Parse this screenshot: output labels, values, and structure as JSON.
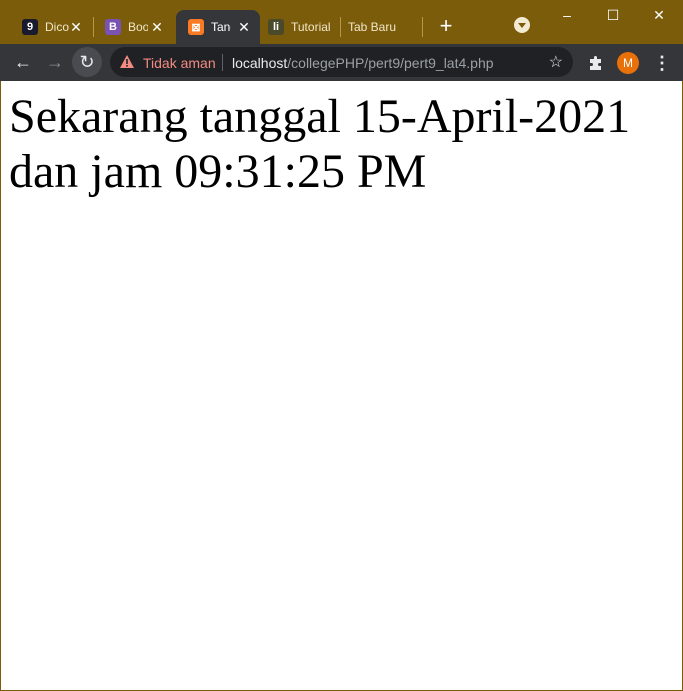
{
  "tabs": [
    {
      "title": "Dicoding",
      "favicon_letter": "9",
      "favicon_color": "#1a1a2e"
    },
    {
      "title": "Bootstrap",
      "favicon_letter": "B",
      "favicon_color": "#7952b3"
    },
    {
      "title": "Tanggal",
      "favicon_letter": "⊠",
      "favicon_color": "#fb7a24",
      "active": true
    },
    {
      "title": "Tutorial",
      "favicon_letter": "li",
      "favicon_color": "#4a4a2a"
    },
    {
      "title": "Tab Baru"
    }
  ],
  "window_controls": {
    "minimize": "–",
    "maximize": "☐",
    "close": "✕"
  },
  "toolbar": {
    "back_icon": "←",
    "forward_icon": "→",
    "reload_icon": "↻",
    "security_label": "Tidak aman",
    "url_host": "localhost",
    "url_path": "/collegePHP/pert9/pert9_lat4.php",
    "bookmark_icon": "☆",
    "profile_initial": "M",
    "menu_icon": "⋮"
  },
  "page": {
    "line1": "Sekarang tanggal 15-April-2021",
    "line2": "dan jam 09:31:25 PM"
  },
  "colors": {
    "frame": "#7a5c0a",
    "toolbar": "#35363a",
    "omnibox": "#202124",
    "warning": "#f28b82",
    "avatar": "#e8710a"
  }
}
